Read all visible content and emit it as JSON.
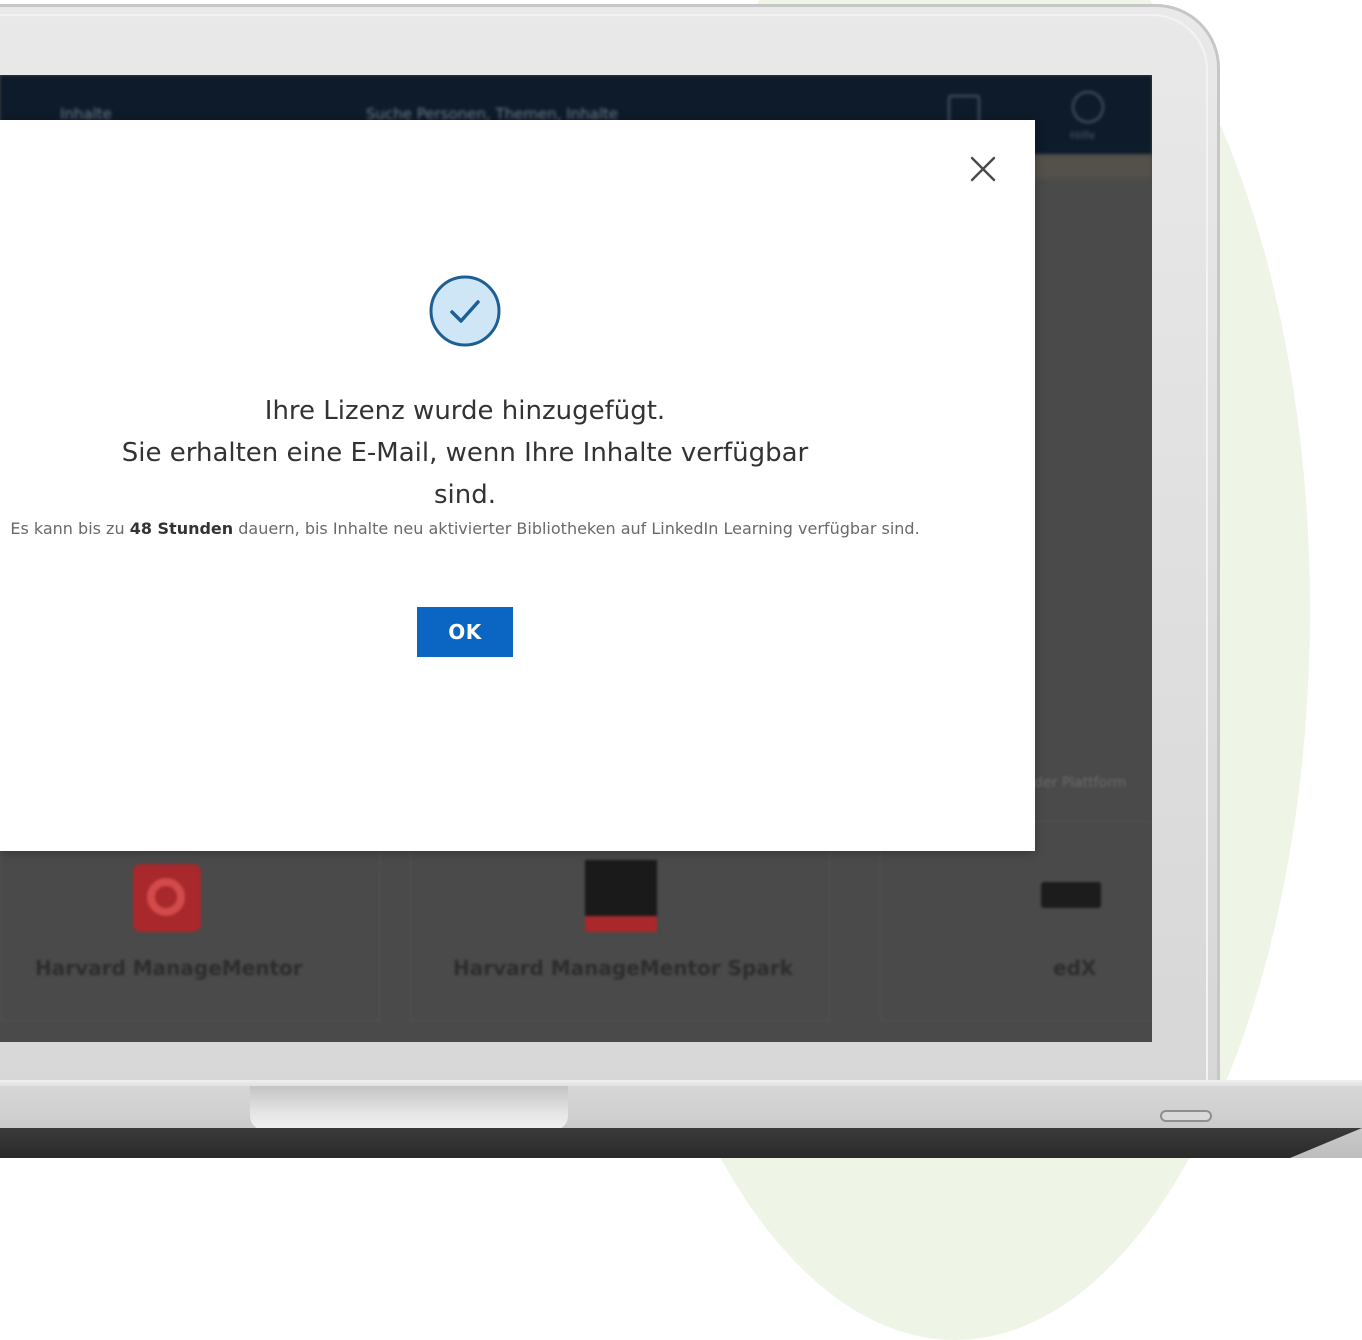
{
  "app": {
    "topbar": {
      "link_text": "Inhalte",
      "search_placeholder": "Suche Personen, Themen, Inhalte",
      "help_label": "Hilfe"
    },
    "side_text": "der Plattform",
    "tiles": [
      {
        "label": "Harvard ManageMentor",
        "logo": "harvard-managementor-logo"
      },
      {
        "label": "Harvard ManageMentor Spark",
        "logo": "harvard-managementor-spark-logo"
      },
      {
        "label": "edX",
        "logo": "edx-logo"
      }
    ]
  },
  "modal": {
    "icon": "checkmark-circle-icon",
    "headline_line1": "Ihre Lizenz wurde hinzugefügt.",
    "headline_line2": "Sie erhalten eine E-Mail, wenn Ihre Inhalte verfügbar sind.",
    "subtext_prefix": "Es kann bis zu ",
    "subtext_bold": "48 Stunden",
    "subtext_suffix": " dauern, bis Inhalte neu aktivierter Bibliotheken auf LinkedIn Learning verfügbar sind.",
    "ok_label": "OK",
    "close_icon": "close-icon"
  },
  "colors": {
    "primary_button": "#0a66c2",
    "check_fill": "#cfe6f7",
    "check_stroke": "#1d5f95",
    "topbar_bg": "#0d1b2a",
    "overlay": "#4a4a4a",
    "decor_circle": "#eef5e6"
  }
}
